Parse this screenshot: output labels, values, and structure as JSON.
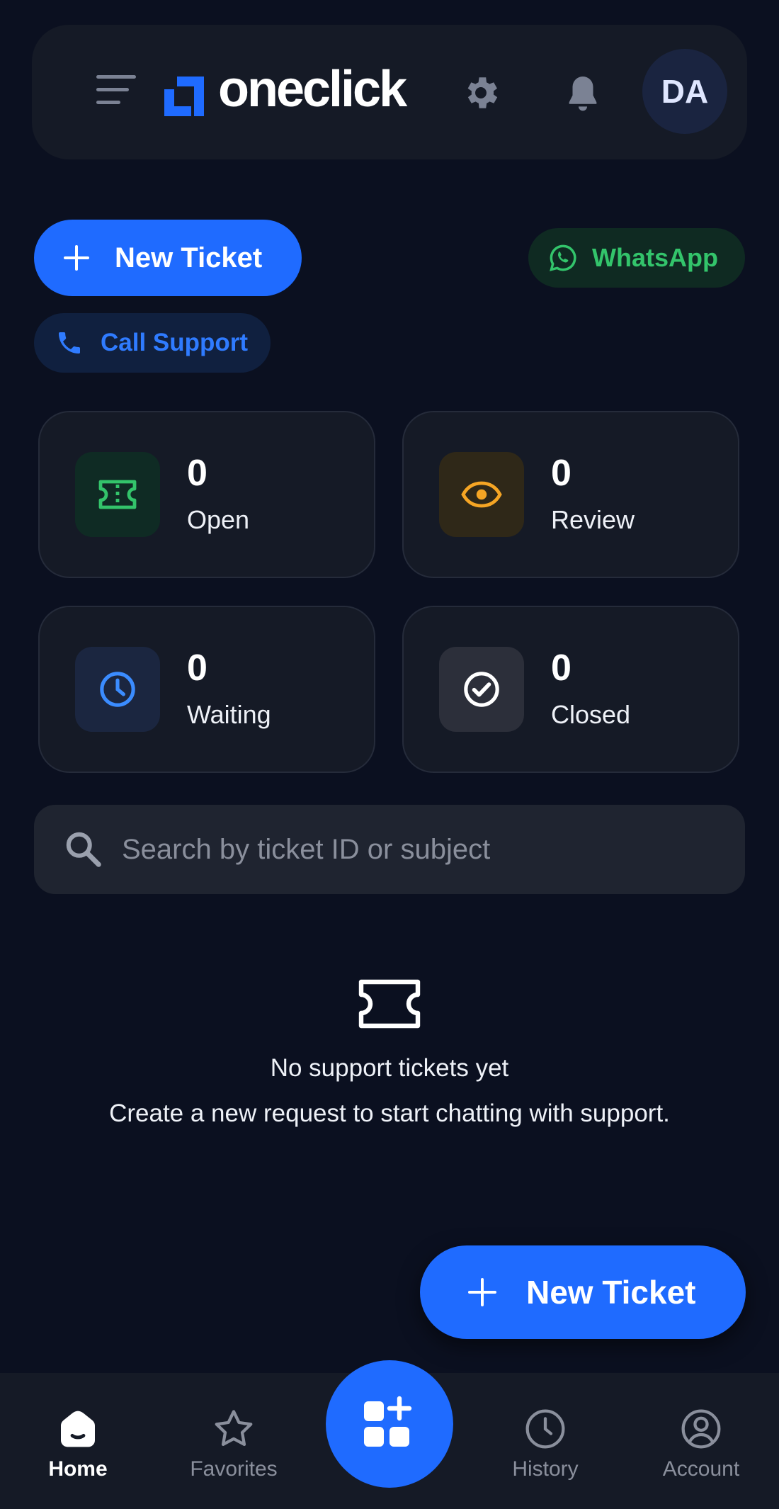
{
  "header": {
    "brand": "oneclick",
    "avatar_initials": "DA"
  },
  "actions": {
    "new_ticket_label": "New Ticket",
    "whatsapp_label": "WhatsApp",
    "call_support_label": "Call Support"
  },
  "stats": [
    {
      "count": "0",
      "label": "Open",
      "icon": "ticket-icon",
      "color": "#33c46b"
    },
    {
      "count": "0",
      "label": "Review",
      "icon": "eye-icon",
      "color": "#f5a524"
    },
    {
      "count": "0",
      "label": "Waiting",
      "icon": "clock-icon",
      "color": "#3b8cff"
    },
    {
      "count": "0",
      "label": "Closed",
      "icon": "check-circle-icon",
      "color": "#ffffff"
    }
  ],
  "search": {
    "placeholder": "Search by ticket ID or subject",
    "value": ""
  },
  "empty_state": {
    "title": "No support tickets yet",
    "subtitle": "Create a new request to start chatting with support."
  },
  "fab": {
    "label": "New Ticket"
  },
  "bottom_nav": {
    "items": [
      {
        "label": "Home",
        "icon": "home-icon",
        "active": true
      },
      {
        "label": "Favorites",
        "icon": "star-icon",
        "active": false
      },
      {
        "label": "History",
        "icon": "clock-icon",
        "active": false
      },
      {
        "label": "Account",
        "icon": "user-circle-icon",
        "active": false
      }
    ],
    "center_icon": "apps-add-icon"
  },
  "colors": {
    "background": "#0b1020",
    "surface": "#151a26",
    "accent": "#1f6bff",
    "whatsapp": "#33c46b",
    "review": "#f5a524"
  }
}
